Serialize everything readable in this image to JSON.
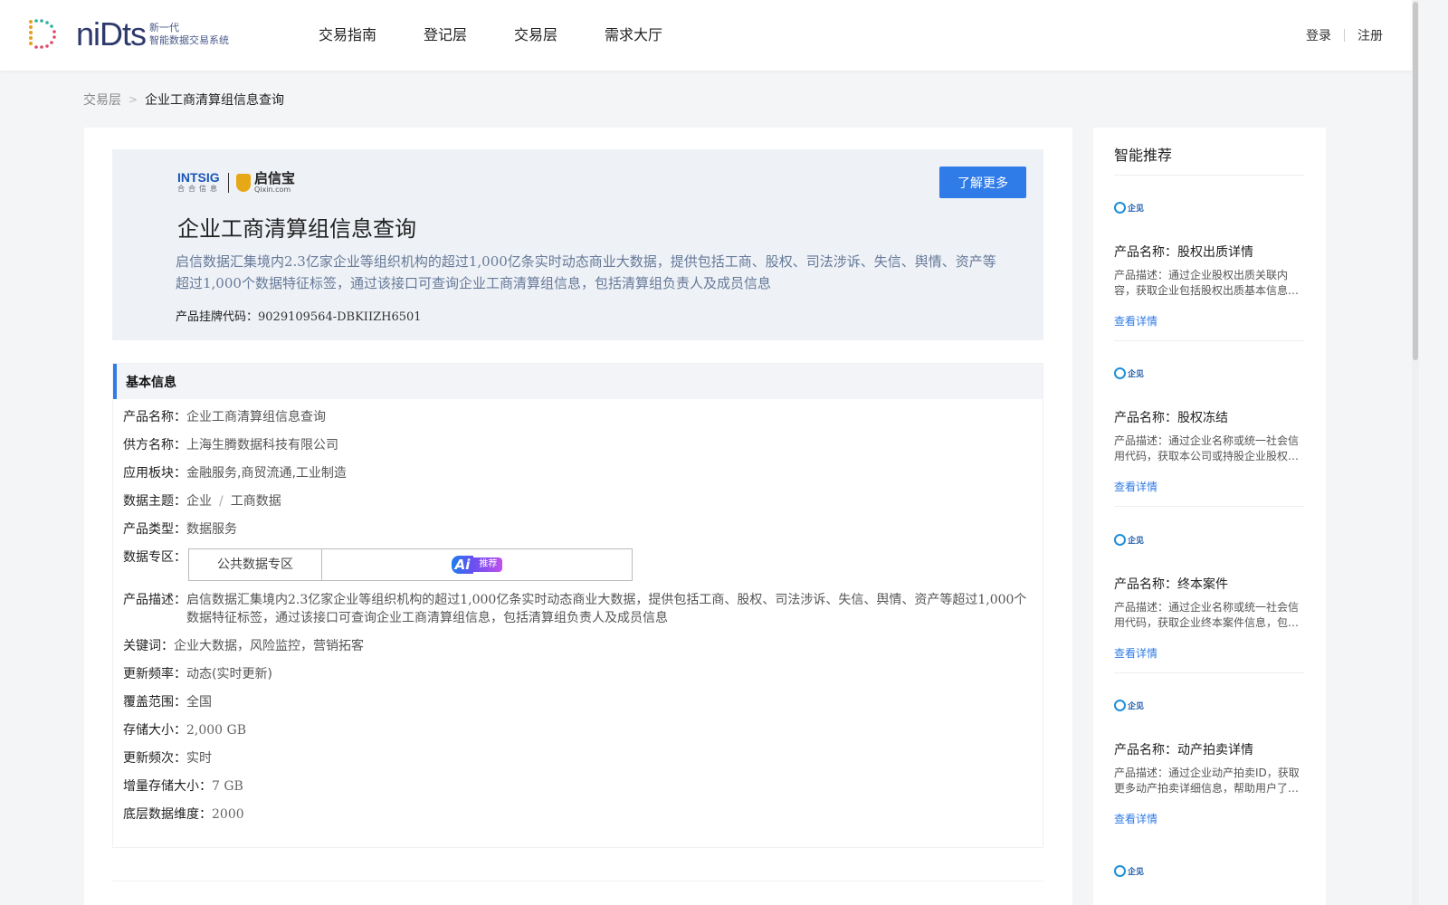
{
  "header": {
    "logo_word": "niDts",
    "logo_sub_1": "新一代",
    "logo_sub_2": "智能数据交易系统",
    "nav": [
      "交易指南",
      "登记层",
      "交易层",
      "需求大厅"
    ],
    "login": "登录",
    "register": "注册"
  },
  "breadcrumb": {
    "parent": "交易层",
    "current": "企业工商清算组信息查询"
  },
  "hero": {
    "brand_intsig": "INTSIG",
    "brand_intsig_sub": "合合信息",
    "brand_qixin": "启信宝",
    "brand_qixin_url": "Qixin.com",
    "more_button": "了解更多",
    "title": "企业工商清算组信息查询",
    "description": "启信数据汇集境内2.3亿家企业等组织机构的超过1,000亿条实时动态商业大数据，提供包括工商、股权、司法涉诉、失信、舆情、资产等超过1,000个数据特征标签，通过该接口可查询企业工商清算组信息，包括清算组负责人及成员信息",
    "code_label": "产品挂牌代码：",
    "code_value": "9029109564-DBKIIZH6501"
  },
  "basic": {
    "section_title": "基本信息",
    "product_name_label": "产品名称：",
    "product_name": "企业工商清算组信息查询",
    "supplier_label": "供方名称：",
    "supplier": "上海生腾数据科技有限公司",
    "sector_label": "应用板块：",
    "sector": "金融服务,商贸流通,工业制造",
    "theme_label": "数据主题：",
    "theme_1": "企业",
    "theme_sep": "/",
    "theme_2": "工商数据",
    "type_label": "产品类型：",
    "type": "数据服务",
    "zone_label": "数据专区：",
    "zone_cell": "公共数据专区",
    "ai_mark": "Ai",
    "ai_tag": "推荐",
    "desc_label": "产品描述：",
    "desc": "启信数据汇集境内2.3亿家企业等组织机构的超过1,000亿条实时动态商业大数据，提供包括工商、股权、司法涉诉、失信、舆情、资产等超过1,000个数据特征标签，通过该接口可查询企业工商清算组信息，包括清算组负责人及成员信息",
    "keywords_label": "关键词：",
    "keywords": "企业大数据，风险监控，营销拓客",
    "freq_label": "更新频率：",
    "freq": "动态(实时更新)",
    "coverage_label": "覆盖范围：",
    "coverage": "全国",
    "storage_label": "存储大小：",
    "storage": "2,000 GB",
    "update_label": "更新频次：",
    "update": "实时",
    "incr_label": "增量存储大小：",
    "incr": "7 GB",
    "dim_label": "底层数据维度：",
    "dim": "2000"
  },
  "side": {
    "title": "智能推荐",
    "logo_text": "企见",
    "link_label": "查看详情",
    "items": [
      {
        "name": "产品名称：股权出质详情",
        "desc": "产品描述：通过企业股权出质关联内容，获取企业包括股权出质基本信息等详细数据"
      },
      {
        "name": "产品名称：股权冻结",
        "desc": "产品描述：通过企业名称或统一社会信用代码，获取本公司或持股企业股权冻结信息"
      },
      {
        "name": "产品名称：终本案件",
        "desc": "产品描述：通过企业名称或统一社会信用代码，获取企业终本案件信息，包括案件详情"
      },
      {
        "name": "产品名称：动产拍卖详情",
        "desc": "产品描述：通过企业动产拍卖ID，获取更多动产拍卖详细信息，帮助用户了解拍卖情况"
      }
    ]
  }
}
